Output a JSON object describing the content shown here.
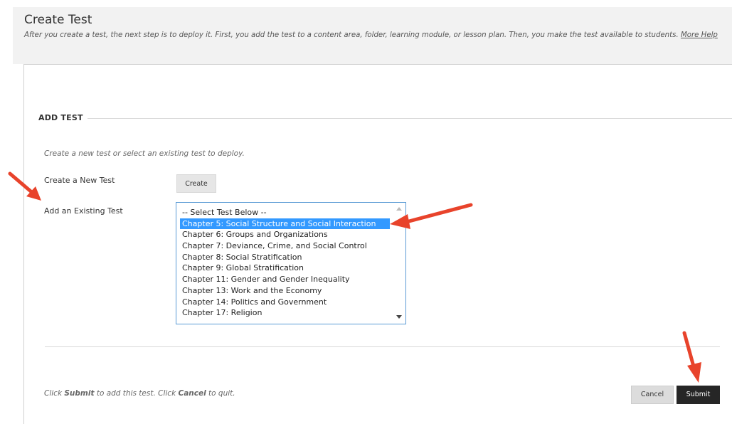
{
  "page": {
    "title": "Create Test",
    "subtitle_prefix": "After you create a test, the next step is to deploy it. First, you add the test to a content area, folder, learning module, or lesson plan. Then, you make the test available to students.",
    "help_link": "More Help"
  },
  "section": {
    "heading": "ADD TEST",
    "instructions": "Create a new test or select an existing test to deploy."
  },
  "create_new": {
    "label": "Create a New Test",
    "button": "Create"
  },
  "existing": {
    "label": "Add an Existing Test",
    "options": [
      "-- Select Test Below --",
      "Chapter 5: Social Structure and Social Interaction",
      "Chapter 6: Groups and Organizations",
      "Chapter 7: Deviance, Crime, and Social Control",
      "Chapter 8: Social Stratification",
      "Chapter 9: Global Stratification",
      "Chapter 11: Gender and Gender Inequality",
      "Chapter 13: Work and the Economy",
      "Chapter 14: Politics and Government",
      "Chapter 17: Religion"
    ],
    "selected": "Chapter 5: Social Structure and Social Interaction"
  },
  "footer": {
    "pre": "Click ",
    "submit_word": "Submit",
    "mid": " to add this test. Click ",
    "cancel_word": "Cancel",
    "post": " to quit.",
    "cancel_button": "Cancel",
    "submit_button": "Submit"
  },
  "colors": {
    "selection": "#3399ff",
    "annotation_arrow": "#e8432b",
    "submit_bg": "#262626"
  },
  "icons": [
    "scroll-up-icon",
    "scroll-down-icon",
    "annotation-arrow-icon"
  ]
}
